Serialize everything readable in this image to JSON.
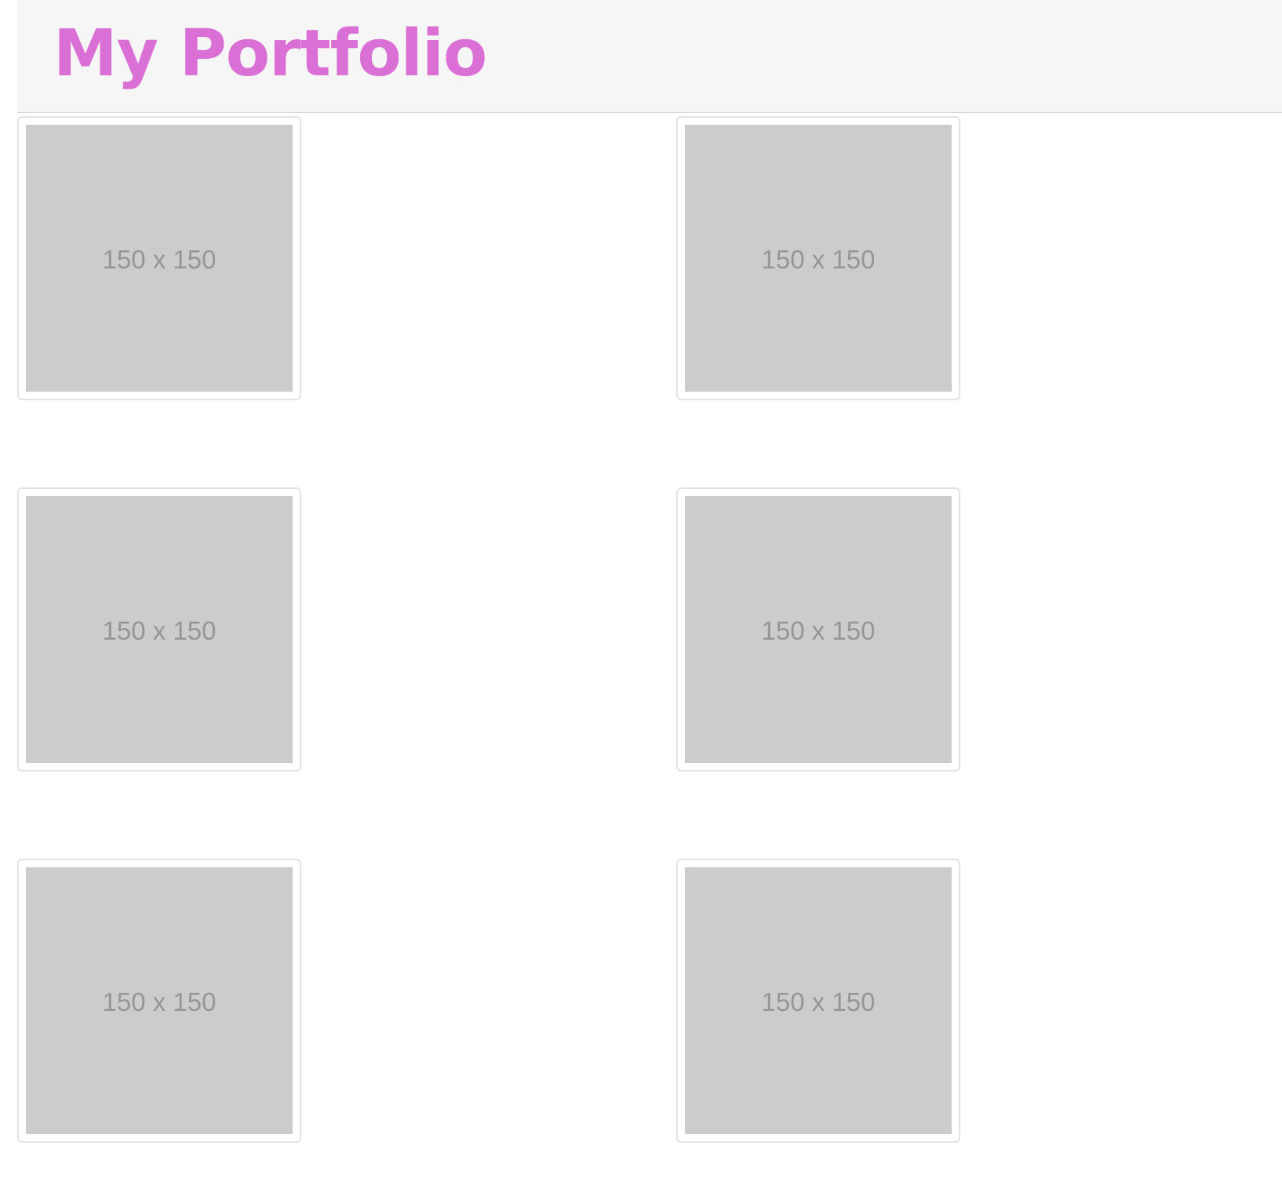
{
  "header": {
    "title": "My Portfolio",
    "title_color": "#da70d6",
    "background_color": "#f6f6f6"
  },
  "gallery": {
    "items": [
      {
        "placeholder_text": "150 x 150"
      },
      {
        "placeholder_text": "150 x 150"
      },
      {
        "placeholder_text": "150 x 150"
      },
      {
        "placeholder_text": "150 x 150"
      },
      {
        "placeholder_text": "150 x 150"
      },
      {
        "placeholder_text": "150 x 150"
      }
    ]
  }
}
